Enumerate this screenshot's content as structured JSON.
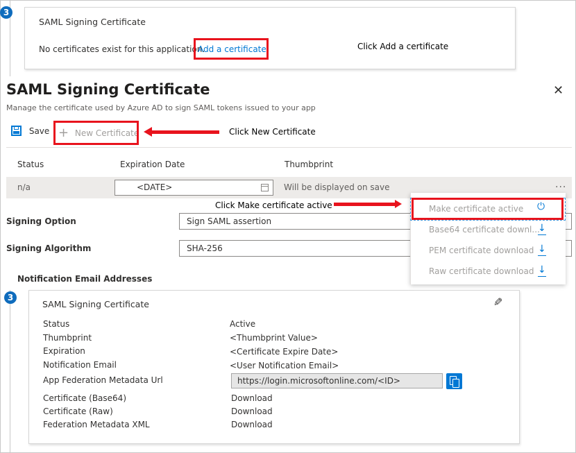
{
  "step_number": "3",
  "top_card": {
    "title": "SAML Signing Certificate",
    "message": "No certificates exist for this application.",
    "add_link": "Add a certificate"
  },
  "annotations": {
    "add_certificate": "Click Add a certificate",
    "new_certificate": "Click New Certificate",
    "make_active": "Click Make certificate active"
  },
  "panel": {
    "title": "SAML Signing Certificate",
    "subtitle": "Manage the certificate used by Azure AD to sign SAML tokens issued to your app",
    "close_icon": "close-icon",
    "toolbar": {
      "save_label": "Save",
      "new_certificate_label": "New Certificate"
    },
    "table": {
      "headers": [
        "Status",
        "Expiration Date",
        "Thumbprint"
      ],
      "row": {
        "status": "n/a",
        "expiration_date": "<DATE>",
        "thumbprint": "Will be displayed on save",
        "more_label": "..."
      }
    },
    "context_menu": [
      {
        "label": "Make certificate active",
        "icon": "power-icon"
      },
      {
        "label": "Base64 certificate downl...",
        "icon": "download-icon"
      },
      {
        "label": "PEM certificate download",
        "icon": "download-icon"
      },
      {
        "label": "Raw certificate download",
        "icon": "download-icon"
      }
    ],
    "signing_option": {
      "label": "Signing Option",
      "value": "Sign SAML assertion"
    },
    "signing_algorithm": {
      "label": "Signing Algorithm",
      "value": "SHA-256"
    },
    "notification_label": "Notification Email Addresses"
  },
  "bottom_card": {
    "title": "SAML Signing Certificate",
    "rows": [
      {
        "label": "Status",
        "value": "Active"
      },
      {
        "label": "Thumbprint",
        "value": "<Thumbprint Value>"
      },
      {
        "label": "Expiration",
        "value": "<Certificate Expire Date>"
      },
      {
        "label": "Notification Email",
        "value": "<User Notification Email>"
      }
    ],
    "metadata_url": {
      "label": "App Federation Metadata Url",
      "value": "https://login.microsoftonline.com/<ID>"
    },
    "downloads": [
      {
        "label": "Certificate (Base64)",
        "link": "Download"
      },
      {
        "label": "Certificate (Raw)",
        "link": "Download"
      },
      {
        "label": "Federation Metadata XML",
        "link": "Download"
      }
    ]
  },
  "colors": {
    "accent": "#0078d4",
    "callout_red": "#e8131d",
    "badge_blue": "#0f6cbd"
  }
}
